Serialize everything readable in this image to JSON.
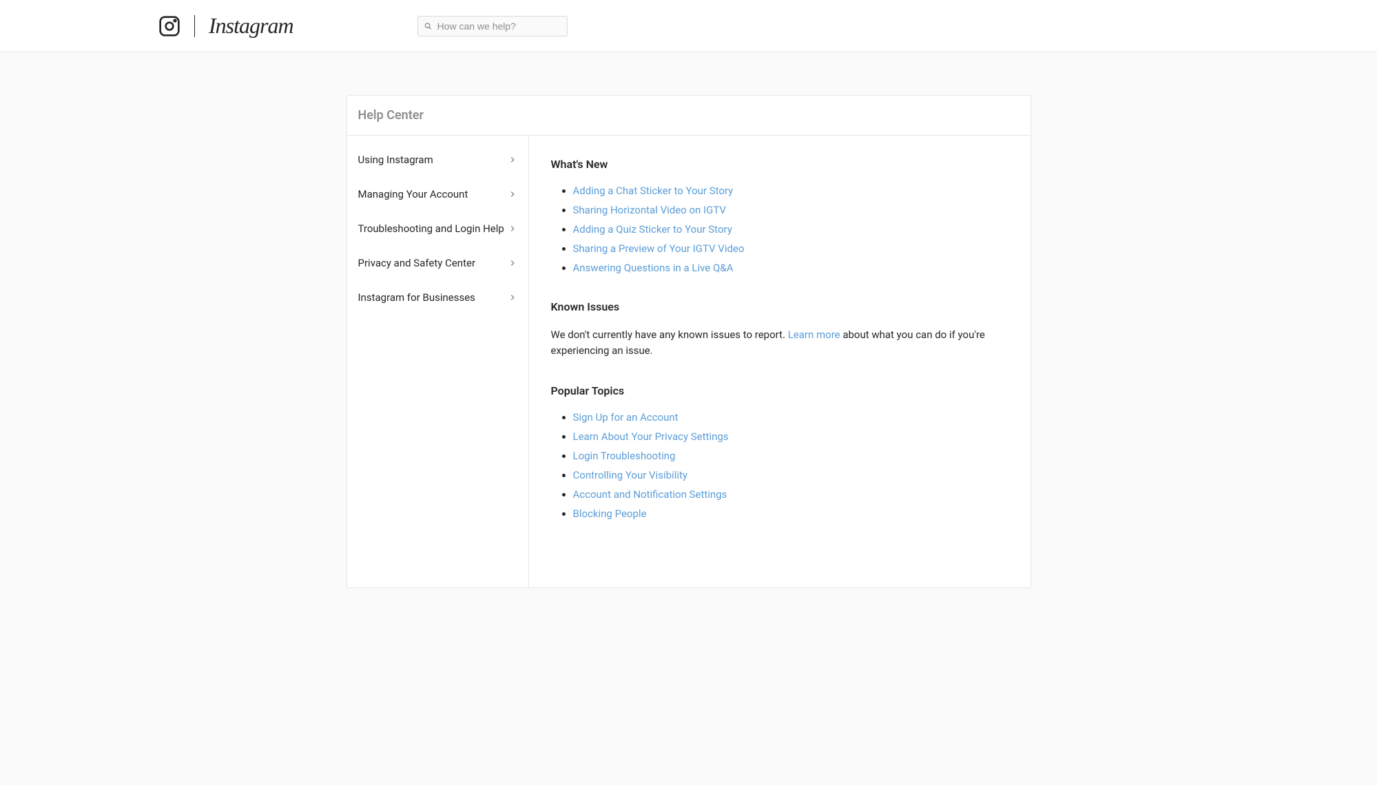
{
  "header": {
    "brand": "Instagram",
    "search_placeholder": "How can we help?"
  },
  "page_title": "Help Center",
  "sidebar": {
    "items": [
      {
        "label": "Using Instagram"
      },
      {
        "label": "Managing Your Account"
      },
      {
        "label": "Troubleshooting and Login Help"
      },
      {
        "label": "Privacy and Safety Center"
      },
      {
        "label": "Instagram for Businesses"
      }
    ]
  },
  "sections": {
    "whats_new": {
      "heading": "What's New",
      "links": [
        "Adding a Chat Sticker to Your Story",
        "Sharing Horizontal Video on IGTV",
        "Adding a Quiz Sticker to Your Story",
        "Sharing a Preview of Your IGTV Video",
        "Answering Questions in a Live Q&A"
      ]
    },
    "known_issues": {
      "heading": "Known Issues",
      "text_before": "We don't currently have any known issues to report. ",
      "link_text": "Learn more",
      "text_after": " about what you can do if you're experiencing an issue."
    },
    "popular_topics": {
      "heading": "Popular Topics",
      "links": [
        "Sign Up for an Account",
        "Learn About Your Privacy Settings",
        "Login Troubleshooting",
        "Controlling Your Visibility",
        "Account and Notification Settings",
        "Blocking People"
      ]
    }
  }
}
